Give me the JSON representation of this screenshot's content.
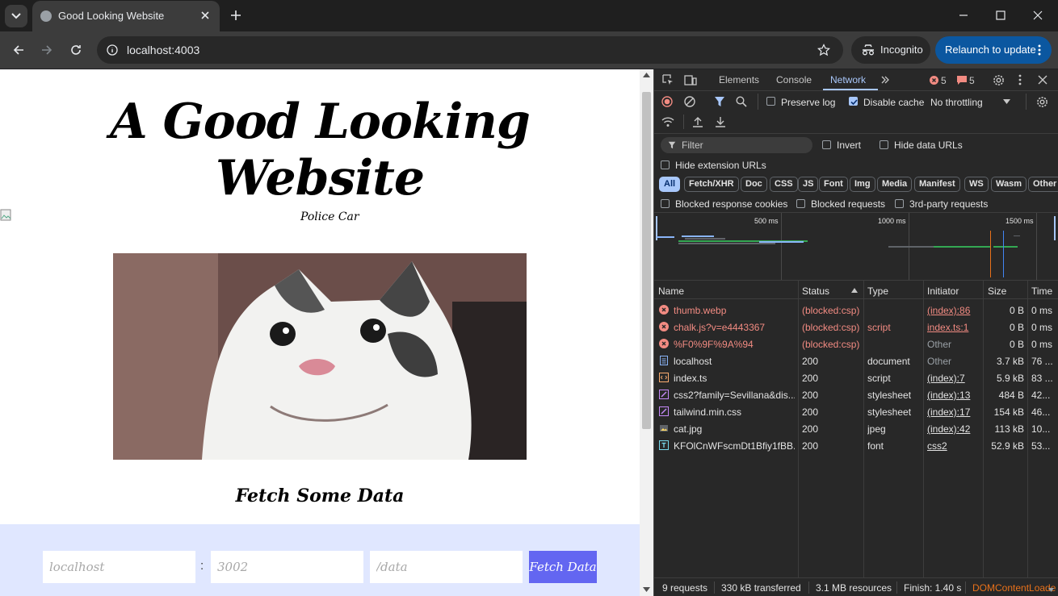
{
  "browser": {
    "tab_title": "Good Looking Website",
    "url": "localhost:4003",
    "incognito_label": "Incognito",
    "relaunch_label": "Relaunch to update"
  },
  "page": {
    "headline": "A Good Looking Website",
    "police_alt": "Police Car",
    "fetch_title": "Fetch Some Data",
    "host_placeholder": "localhost",
    "colon": ":",
    "port_placeholder": "3002",
    "path_placeholder": "/data",
    "fetch_button": "Fetch Data"
  },
  "devtools": {
    "tabs": [
      "Elements",
      "Console",
      "Network"
    ],
    "active_tab": "Network",
    "error_count": "5",
    "issue_count": "5",
    "preserve_log": "Preserve log",
    "disable_cache": "Disable cache",
    "throttling": "No throttling",
    "filter_placeholder": "Filter",
    "invert": "Invert",
    "hide_data_urls": "Hide data URLs",
    "hide_extension_urls": "Hide extension URLs",
    "type_filters": [
      "All",
      "Fetch/XHR",
      "Doc",
      "CSS",
      "JS",
      "Font",
      "Img",
      "Media",
      "Manifest",
      "WS",
      "Wasm",
      "Other"
    ],
    "blocked_response_cookies": "Blocked response cookies",
    "blocked_requests": "Blocked requests",
    "third_party": "3rd-party requests",
    "timeline_ticks": [
      "500 ms",
      "1000 ms",
      "1500 ms"
    ],
    "columns": [
      "Name",
      "Status",
      "Type",
      "Initiator",
      "Size",
      "Time"
    ],
    "rows": [
      {
        "name": "thumb.webp",
        "status": "(blocked:csp)",
        "type": "",
        "initiator": "(index):86",
        "size": "0 B",
        "time": "0 ms",
        "kind": "error"
      },
      {
        "name": "chalk.js?v=e4443367",
        "status": "(blocked:csp)",
        "type": "script",
        "initiator": "index.ts:1",
        "size": "0 B",
        "time": "0 ms",
        "kind": "error"
      },
      {
        "name": "%F0%9F%9A%94",
        "status": "(blocked:csp)",
        "type": "",
        "initiator": "Other",
        "size": "0 B",
        "time": "0 ms",
        "kind": "error"
      },
      {
        "name": "localhost",
        "status": "200",
        "type": "document",
        "initiator": "Other",
        "size": "3.7 kB",
        "time": "76 ...",
        "kind": "doc"
      },
      {
        "name": "index.ts",
        "status": "200",
        "type": "script",
        "initiator": "(index):7",
        "size": "5.9 kB",
        "time": "83 ...",
        "kind": "script"
      },
      {
        "name": "css2?family=Sevillana&dis...",
        "status": "200",
        "type": "stylesheet",
        "initiator": "(index):13",
        "size": "484 B",
        "time": "42...",
        "kind": "css"
      },
      {
        "name": "tailwind.min.css",
        "status": "200",
        "type": "stylesheet",
        "initiator": "(index):17",
        "size": "154 kB",
        "time": "46...",
        "kind": "css"
      },
      {
        "name": "cat.jpg",
        "status": "200",
        "type": "jpeg",
        "initiator": "(index):42",
        "size": "113 kB",
        "time": "10...",
        "kind": "img"
      },
      {
        "name": "KFOlCnWFscmDt1Bfiy1fBB...",
        "status": "200",
        "type": "font",
        "initiator": "css2",
        "size": "52.9 kB",
        "time": "53...",
        "kind": "font"
      }
    ],
    "summary": {
      "requests": "9 requests",
      "transferred": "330 kB transferred",
      "resources": "3.1 MB resources",
      "finish": "Finish: 1.40 s",
      "dcl": "DOMContentLoade"
    }
  },
  "colors": {
    "accent": "#a8c7fa",
    "error": "#f28b82",
    "button": "#6366f1",
    "panel": "#e0e7ff"
  }
}
